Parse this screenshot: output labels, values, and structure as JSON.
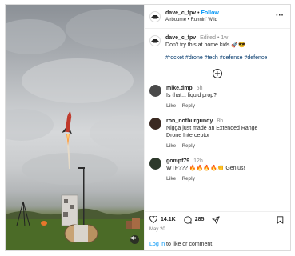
{
  "post": {
    "username": "dave_c_fpv",
    "follow_label": "Follow",
    "separator": "•",
    "location": "Airbourne • Runnin' Wild",
    "more_icon": "more-horizontal-icon",
    "caption": {
      "edited_label": "Edited",
      "time": "1w",
      "text": "Don't try this at home kids 🚀😎",
      "hashtags": "#rocket #drone #tech #defense #defence"
    },
    "load_more_icon": "plus-circle-icon",
    "comments": [
      {
        "username": "mike.dmp",
        "time": "5h",
        "text": "Is that... liquid prop?",
        "like_label": "Like",
        "reply_label": "Reply",
        "avatar_color": "#4a4a4a"
      },
      {
        "username": "ron_notburgundy",
        "time": "8h",
        "text": "Nigga just made an Extended Range Drone Interceptor",
        "like_label": "Like",
        "reply_label": "Reply",
        "avatar_color": "#3b2a22"
      },
      {
        "username": "gompf79",
        "time": "12h",
        "text": "WTF??? 🔥🔥🔥🔥👏 Genius!",
        "like_label": "Like",
        "reply_label": "Reply",
        "avatar_color": "#2e3a2c"
      }
    ],
    "likes_count": "14.1K",
    "comments_count": "285",
    "date": "May 20",
    "login_link": "Log in",
    "login_suffix": " to like or comment."
  },
  "icons": {
    "like": "heart-icon",
    "comment": "comment-bubble-icon",
    "share": "paper-plane-icon",
    "save": "bookmark-icon",
    "mute": "speaker-muted-icon"
  },
  "colors": {
    "accent": "#0095f6",
    "hashtag": "#00376b",
    "muted": "#8e8e8e",
    "rocket_body": "#c0392b"
  }
}
